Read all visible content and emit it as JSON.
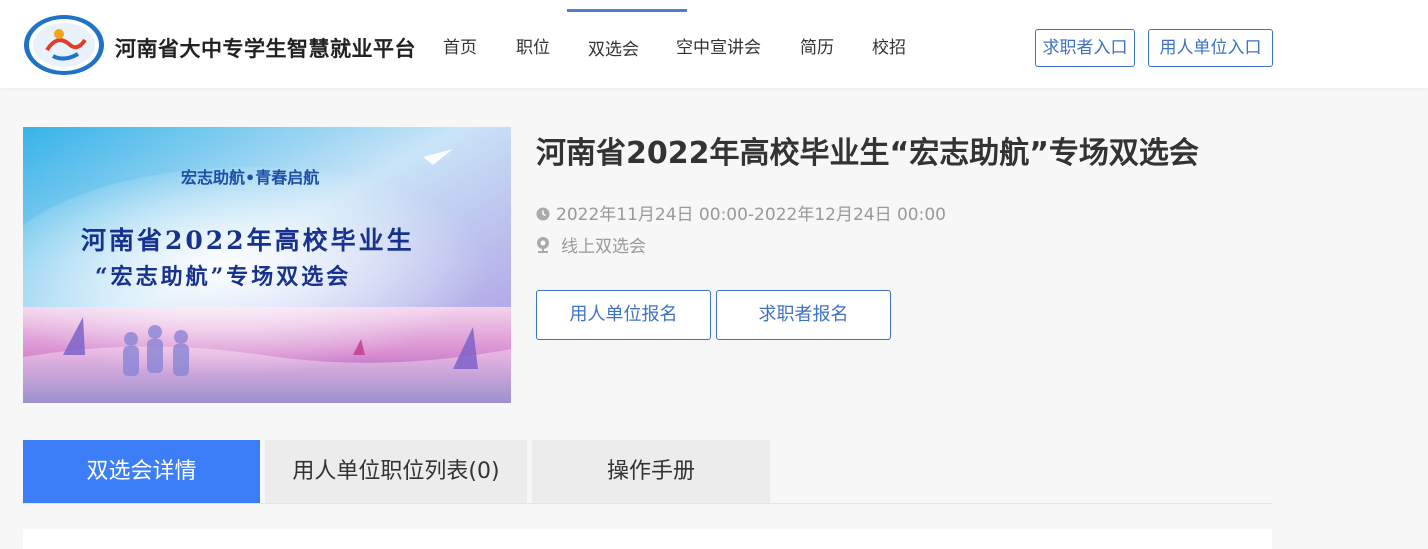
{
  "header": {
    "brand": "河南省大中专学生智慧就业平台",
    "nav": [
      "首页",
      "职位",
      "双选会",
      "空中宣讲会",
      "简历",
      "校招"
    ],
    "active_nav": "双选会",
    "job_seeker_login": "求职者入口",
    "employer_login": "用人单位入口"
  },
  "banner": {
    "slogan": "宏志助航•青春启航",
    "line1": "河南省2022年高校毕业生",
    "line2": "“宏志助航”专场双选会"
  },
  "event": {
    "title": "河南省2022年高校毕业生“宏志助航”专场双选会",
    "time": "2022年11月24日 00:00-2022年12月24日 00:00",
    "location": "线上双选会",
    "employer_signup": "用人单位报名",
    "seeker_signup": "求职者报名"
  },
  "tabs": [
    "双选会详情",
    "用人单位职位列表(0)",
    "操作手册"
  ],
  "colors": {
    "accent": "#3c7ef7",
    "link_blue": "#3d72c4",
    "nav_indicator": "#4a7fd4"
  },
  "icons": {
    "time": "clock-icon",
    "location": "map-pin-icon",
    "logo": "platform-logo-icon"
  }
}
